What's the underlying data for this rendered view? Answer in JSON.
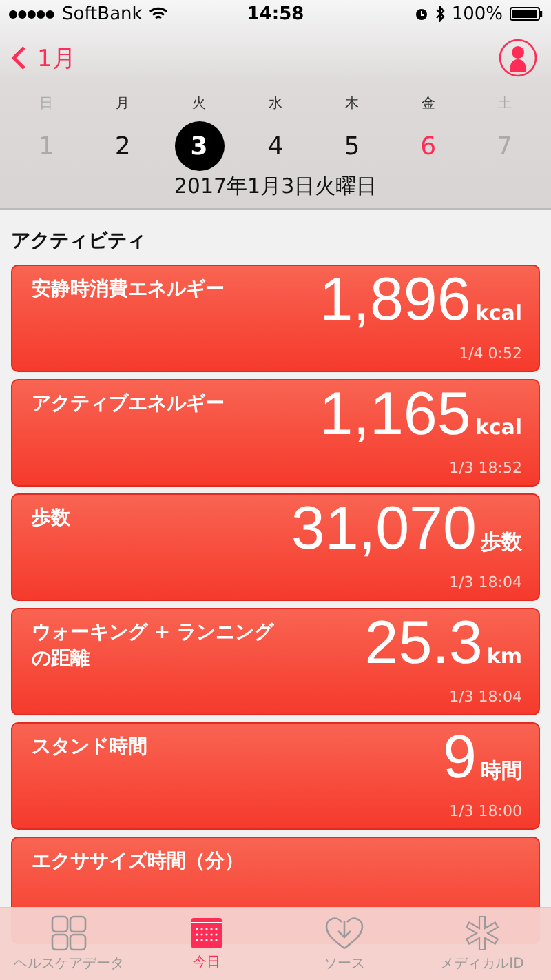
{
  "status_bar": {
    "carrier": "SoftBank",
    "time": "14:58",
    "battery": "100%"
  },
  "nav": {
    "back_label": "1月"
  },
  "weekdays": [
    {
      "label": "日",
      "muted": true
    },
    {
      "label": "月",
      "muted": false
    },
    {
      "label": "火",
      "muted": false
    },
    {
      "label": "水",
      "muted": false
    },
    {
      "label": "木",
      "muted": false
    },
    {
      "label": "金",
      "muted": false
    },
    {
      "label": "土",
      "muted": true
    }
  ],
  "days": [
    {
      "label": "1",
      "selected": false,
      "kind": "muted"
    },
    {
      "label": "2",
      "selected": false,
      "kind": "normal"
    },
    {
      "label": "3",
      "selected": true,
      "kind": "normal"
    },
    {
      "label": "4",
      "selected": false,
      "kind": "normal"
    },
    {
      "label": "5",
      "selected": false,
      "kind": "normal"
    },
    {
      "label": "6",
      "selected": false,
      "kind": "highlight"
    },
    {
      "label": "7",
      "selected": false,
      "kind": "muted"
    }
  ],
  "date_label": "2017年1月3日火曜日",
  "section_title": "アクティビティ",
  "cards": [
    {
      "title": "安静時消費エネルギー",
      "value": "1,896",
      "unit": "kcal",
      "time": "1/4 0:52"
    },
    {
      "title": "アクティブエネルギー",
      "value": "1,165",
      "unit": "kcal",
      "time": "1/3 18:52"
    },
    {
      "title": "歩数",
      "value": "31,070",
      "unit": "歩数",
      "time": "1/3 18:04"
    },
    {
      "title": "ウォーキング + ランニングの距離",
      "value": "25.3",
      "unit": "km",
      "time": "1/3 18:04"
    },
    {
      "title": "スタンド時間",
      "value": "9",
      "unit": "時間",
      "time": "1/3 18:00"
    },
    {
      "title": "エクササイズ時間（分）"
    }
  ],
  "tabs": [
    {
      "label": "ヘルスケアデータ",
      "kind": "grid",
      "selected": false
    },
    {
      "label": "今日",
      "kind": "calendar",
      "selected": true
    },
    {
      "label": "ソース",
      "kind": "heart",
      "selected": false
    },
    {
      "label": "メディカルID",
      "kind": "asterisk",
      "selected": false
    }
  ]
}
